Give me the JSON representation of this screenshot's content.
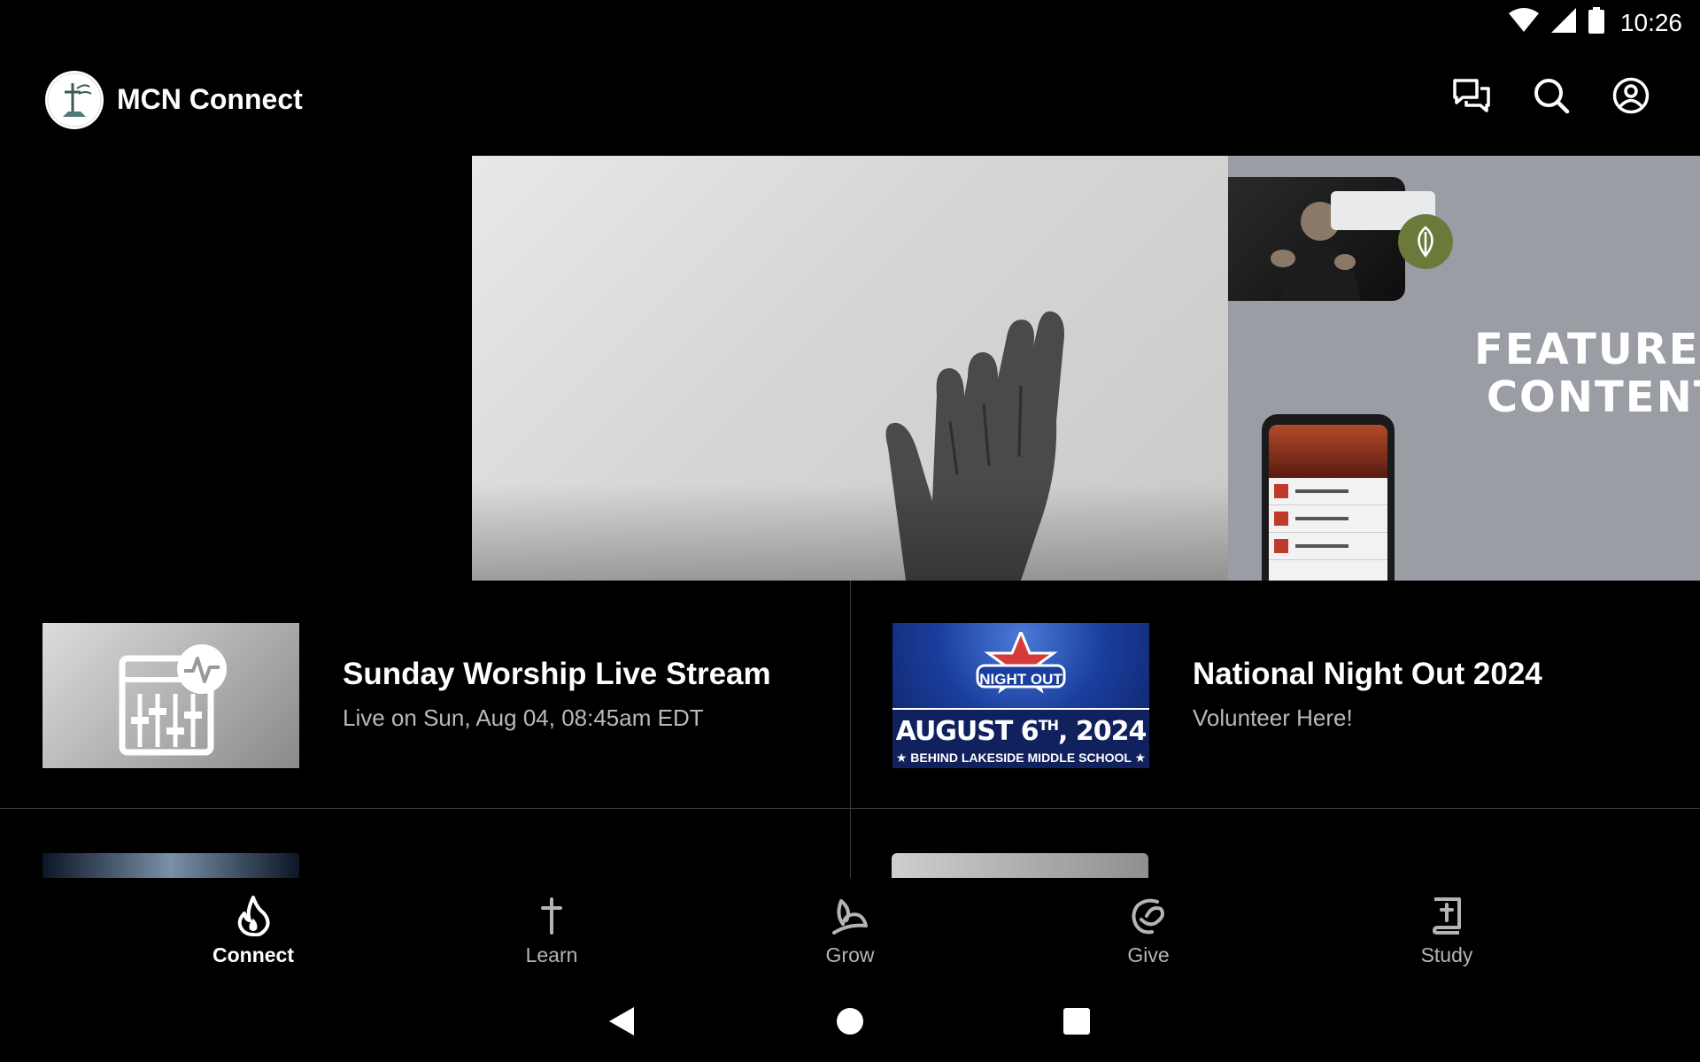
{
  "status_bar": {
    "time": "10:26",
    "icons": [
      "wifi-icon",
      "cell-signal-icon",
      "battery-icon"
    ]
  },
  "app_bar": {
    "title": "MCN Connect",
    "actions": [
      "chat-icon",
      "search-icon",
      "account-icon"
    ]
  },
  "hero": {
    "slides": [
      {
        "name": "hand-photo"
      },
      {
        "text": "FEATURED\nCONTENT"
      }
    ],
    "active_slide": 0,
    "slide_count": 2
  },
  "cards": [
    {
      "title": "Sunday Worship Live Stream",
      "subtitle": "Live on Sun, Aug 04, 08:45am EDT",
      "thumb_icon": "live-stream-mixer-icon"
    },
    {
      "title": "National Night Out 2024",
      "subtitle": "Volunteer Here!",
      "thumb": {
        "badge_text": "NIGHT OUT",
        "date_main": "AUGUST 6",
        "date_sup": "TH",
        "date_year": ", 2024",
        "location": "★ BEHIND LAKESIDE MIDDLE SCHOOL ★"
      }
    }
  ],
  "bottom_nav": {
    "items": [
      {
        "label": "Connect",
        "icon": "flame-icon",
        "active": true
      },
      {
        "label": "Learn",
        "icon": "cross-icon",
        "active": false
      },
      {
        "label": "Grow",
        "icon": "sprout-icon",
        "active": false
      },
      {
        "label": "Give",
        "icon": "give-icon",
        "active": false
      },
      {
        "label": "Study",
        "icon": "bible-icon",
        "active": false
      }
    ]
  },
  "colors": {
    "background": "#000000",
    "text_primary": "#ffffff",
    "text_secondary": "#b9b9b9",
    "divider": "#3a3a3a"
  }
}
